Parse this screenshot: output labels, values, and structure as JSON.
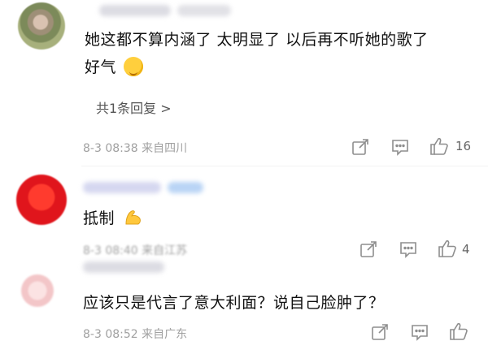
{
  "comments": [
    {
      "text_line1": "她这都不算内涵了 太明显了 以后再不听她的歌了",
      "text_line2": "好气",
      "replies_link": "共1条回复 >",
      "meta": "8-3 08:38  来自四川",
      "likes": "16"
    },
    {
      "text_line1": "抵制",
      "meta": "8-3 08:40  来自江苏",
      "likes": "4"
    },
    {
      "text_line1": "应该只是代言了意大利面？说自己脸肿了？",
      "meta": "8-3 08:52  来自广东"
    }
  ],
  "icons": {
    "emoji_1": "smiling-face-emoji",
    "emoji_2": "flexed-biceps-emoji",
    "share": "share-icon",
    "comment": "comment-icon",
    "like": "thumbs-up-icon"
  },
  "colors": {
    "meta_text": "#a0a0a0",
    "icon": "#9a9a9a",
    "username_blur_blue": "#b9d4f5"
  }
}
